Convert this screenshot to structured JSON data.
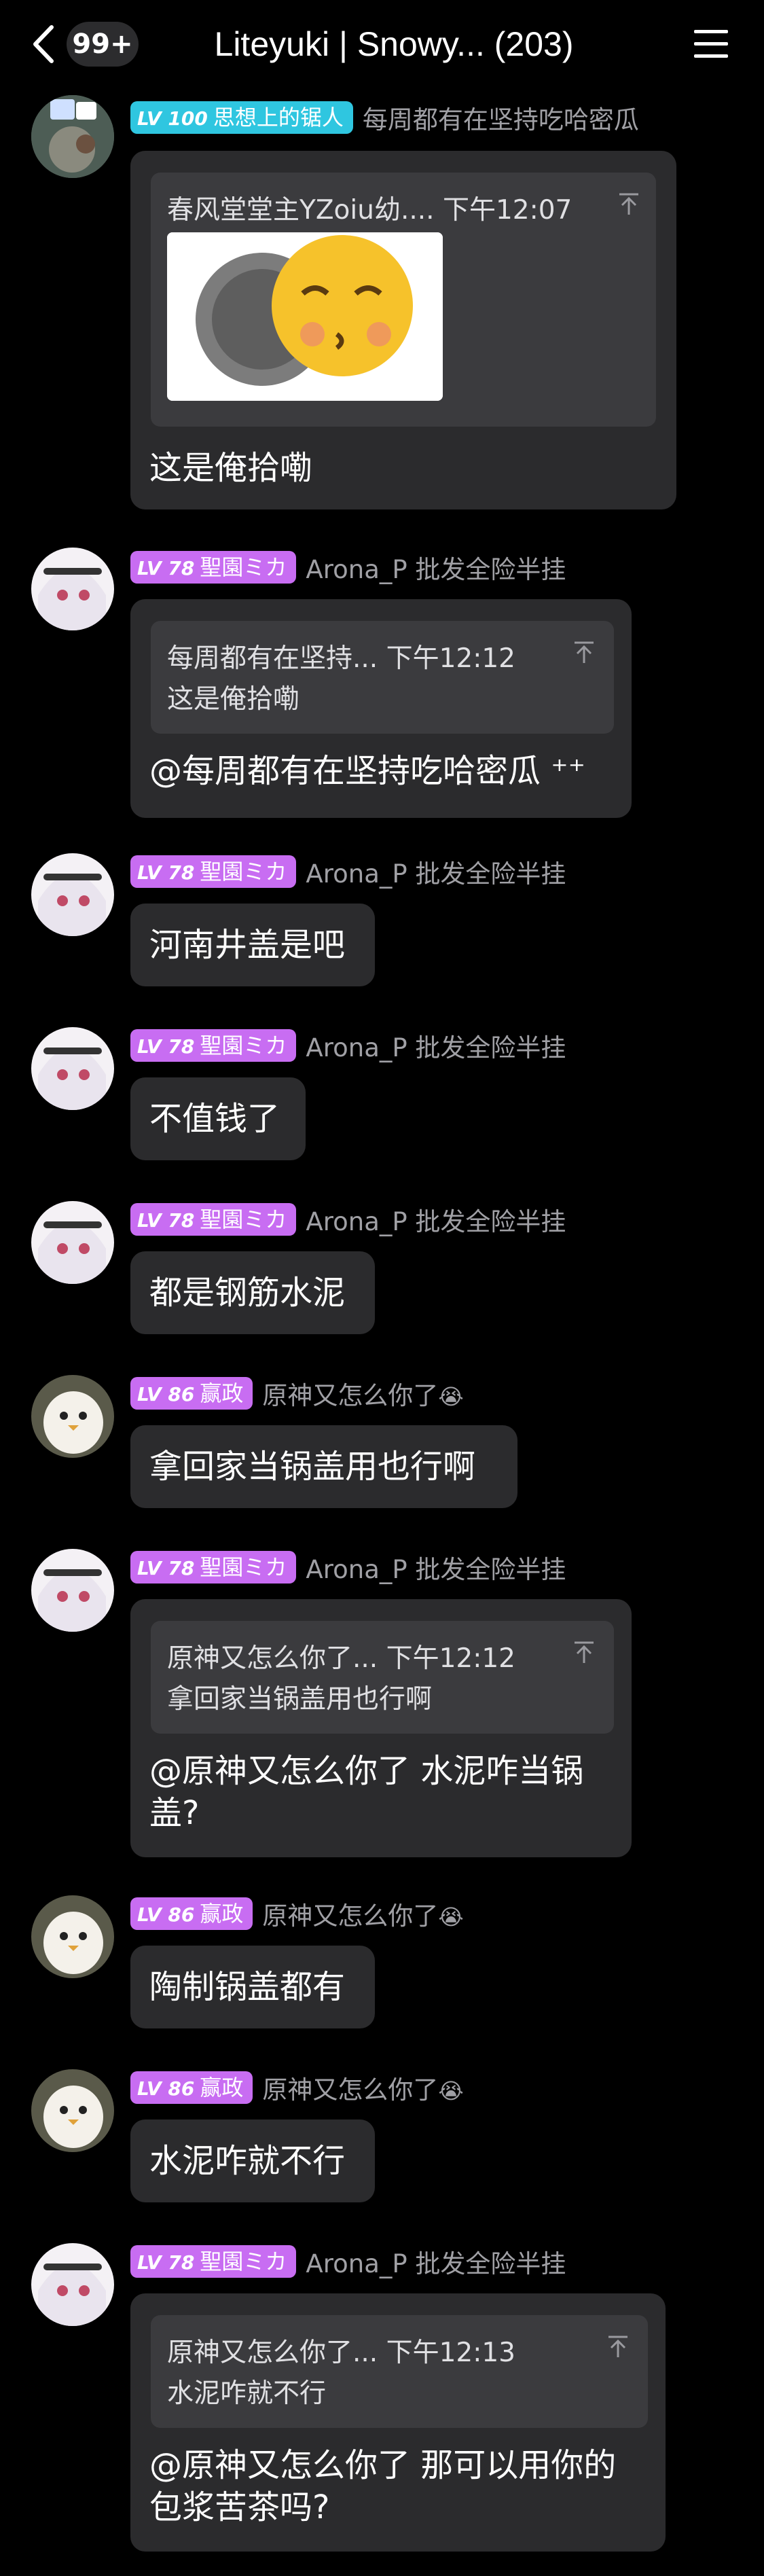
{
  "header": {
    "unread_count": "99+",
    "title": "Liteyuki | Snowy... (203)"
  },
  "messages": [
    {
      "level": "LV 100",
      "title": "思想上的锯人",
      "nick": "每周都有在坚持吃哈密瓜",
      "quote_head": "春风堂堂主YZoiu幼.... 下午12:07",
      "text": "这是俺拾嘞"
    },
    {
      "level": "LV 78",
      "title": "聖園ミカ",
      "nick": "Arona_P 批发全险半挂",
      "quote_head": "每周都有在坚持... 下午12:12",
      "quote_body": "这是俺拾嘞",
      "text": "@每周都有在坚持吃哈密瓜 ⁺⁺"
    },
    {
      "level": "LV 78",
      "title": "聖園ミカ",
      "nick": "Arona_P 批发全险半挂",
      "text": "河南井盖是吧"
    },
    {
      "level": "LV 78",
      "title": "聖園ミカ",
      "nick": "Arona_P 批发全险半挂",
      "text": "不值钱了"
    },
    {
      "level": "LV 78",
      "title": "聖園ミカ",
      "nick": "Arona_P 批发全险半挂",
      "text": "都是钢筋水泥"
    },
    {
      "level": "LV 86",
      "title": "赢政",
      "nick": "原神又怎么你了",
      "nick_emoji": "😭",
      "text": "拿回家当锅盖用也行啊"
    },
    {
      "level": "LV 78",
      "title": "聖園ミカ",
      "nick": "Arona_P 批发全险半挂",
      "quote_head": "原神又怎么你了... 下午12:12",
      "quote_body": "拿回家当锅盖用也行啊",
      "text_line1": "@原神又怎么你了 水泥咋当锅",
      "text_line2": "盖?"
    },
    {
      "level": "LV 86",
      "title": "赢政",
      "nick": "原神又怎么你了",
      "nick_emoji": "😭",
      "text": "陶制锅盖都有"
    },
    {
      "level": "LV 86",
      "title": "赢政",
      "nick": "原神又怎么你了",
      "nick_emoji": "😭",
      "text": "水泥咋就不行"
    },
    {
      "level": "LV 78",
      "title": "聖園ミカ",
      "nick": "Arona_P 批发全险半挂",
      "quote_head": "原神又怎么你了... 下午12:13",
      "quote_body": "水泥咋就不行",
      "text_line1": "@原神又怎么你了 那可以用你的",
      "text_line2": "包浆苦茶吗?"
    }
  ],
  "colors": {
    "badge_lv100": "#2fc6e0",
    "badge_purple": "#c86df2",
    "bubble": "#2b2b2d",
    "quote": "#3b3b3e"
  },
  "icons": [
    "back-icon",
    "menu-icon",
    "pin-icon"
  ]
}
